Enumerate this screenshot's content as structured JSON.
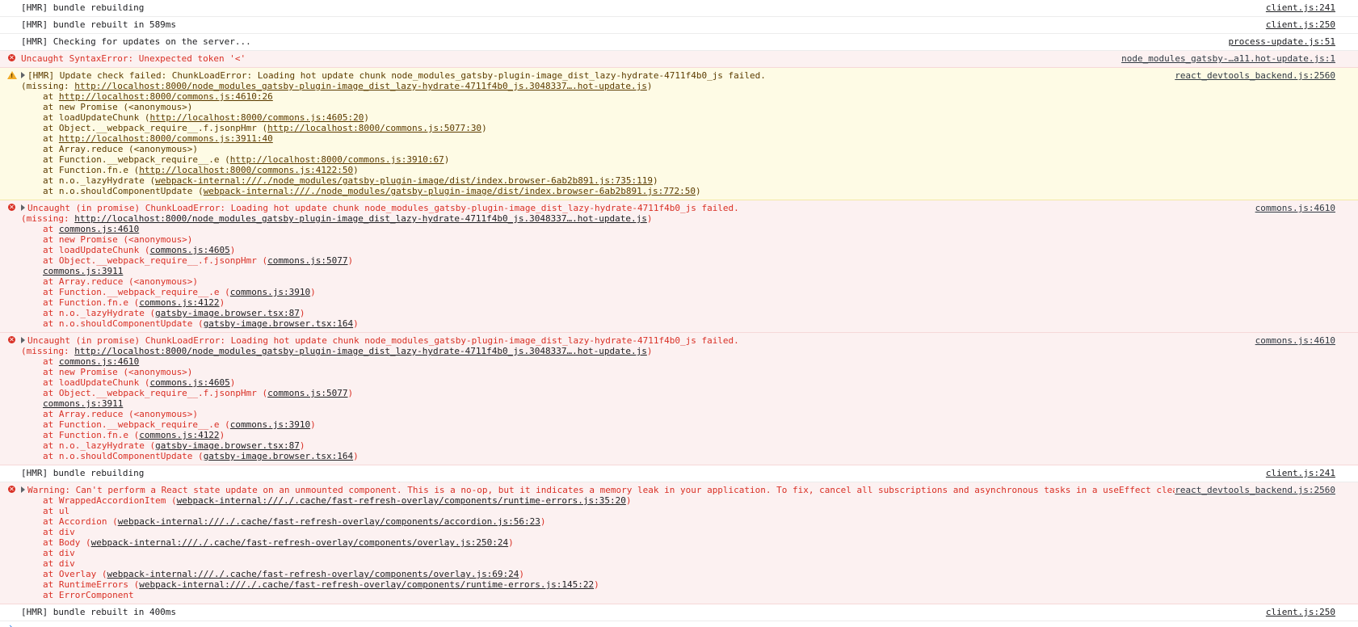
{
  "messages": [
    {
      "level": "info",
      "text": "[HMR] bundle rebuilding",
      "source": "client.js:241"
    },
    {
      "level": "info",
      "text": "[HMR] bundle rebuilt in 589ms",
      "source": "client.js:250"
    },
    {
      "level": "info",
      "text": "[HMR] Checking for updates on the server...",
      "source": "process-update.js:51"
    },
    {
      "level": "error",
      "text": "Uncaught SyntaxError: Unexpected token '<'",
      "source": "node_modules_gatsby-…a11.hot-update.js:1"
    },
    {
      "level": "warning",
      "expandable": true,
      "text": "[HMR] Update check failed: ChunkLoadError: Loading hot update chunk node_modules_gatsby-plugin-image_dist_lazy-hydrate-4711f4b0_js failed.",
      "missing_prefix": "(missing: ",
      "missing_url": "http://localhost:8000/node_modules_gatsby-plugin-image_dist_lazy-hydrate-4711f4b0_js.3048337….hot-update.js",
      "missing_suffix": ")",
      "source": "react_devtools_backend.js:2560",
      "stack": [
        {
          "pre": "at ",
          "link": "http://localhost:8000/commons.js:4610:26",
          "post": ""
        },
        {
          "pre": "at new Promise (<anonymous>)",
          "link": "",
          "post": ""
        },
        {
          "pre": "at loadUpdateChunk (",
          "link": "http://localhost:8000/commons.js:4605:20",
          "post": ")"
        },
        {
          "pre": "at Object.__webpack_require__.f.jsonpHmr (",
          "link": "http://localhost:8000/commons.js:5077:30",
          "post": ")"
        },
        {
          "pre": "at ",
          "link": "http://localhost:8000/commons.js:3911:40",
          "post": ""
        },
        {
          "pre": "at Array.reduce (<anonymous>)",
          "link": "",
          "post": ""
        },
        {
          "pre": "at Function.__webpack_require__.e (",
          "link": "http://localhost:8000/commons.js:3910:67",
          "post": ")"
        },
        {
          "pre": "at Function.fn.e (",
          "link": "http://localhost:8000/commons.js:4122:50",
          "post": ")"
        },
        {
          "pre": "at n.o._lazyHydrate (",
          "link": "webpack-internal:///./node_modules/gatsby-plugin-image/dist/index.browser-6ab2b891.js:735:119",
          "post": ")"
        },
        {
          "pre": "at n.o.shouldComponentUpdate (",
          "link": "webpack-internal:///./node_modules/gatsby-plugin-image/dist/index.browser-6ab2b891.js:772:50",
          "post": ")"
        }
      ]
    },
    {
      "level": "error",
      "expandable": true,
      "text": "Uncaught (in promise) ChunkLoadError: Loading hot update chunk node_modules_gatsby-plugin-image_dist_lazy-hydrate-4711f4b0_js failed.",
      "missing_prefix": "(missing: ",
      "missing_url": "http://localhost:8000/node_modules_gatsby-plugin-image_dist_lazy-hydrate-4711f4b0_js.3048337….hot-update.js",
      "missing_suffix": ")",
      "source": "commons.js:4610",
      "stack": [
        {
          "pre": "at ",
          "link": "commons.js:4610",
          "post": ""
        },
        {
          "pre": "at new Promise (<anonymous>)",
          "link": "",
          "post": ""
        },
        {
          "pre": "at loadUpdateChunk (",
          "link": "commons.js:4605",
          "post": ")"
        },
        {
          "pre": "at Object.__webpack_require__.f.jsonpHmr (",
          "link": "commons.js:5077",
          "post": ")"
        },
        {
          "pre": "",
          "link": "commons.js:3911",
          "post": ""
        },
        {
          "pre": "at Array.reduce (<anonymous>)",
          "link": "",
          "post": ""
        },
        {
          "pre": "at Function.__webpack_require__.e (",
          "link": "commons.js:3910",
          "post": ")"
        },
        {
          "pre": "at Function.fn.e (",
          "link": "commons.js:4122",
          "post": ")"
        },
        {
          "pre": "at n.o._lazyHydrate (",
          "link": "gatsby-image.browser.tsx:87",
          "post": ")"
        },
        {
          "pre": "at n.o.shouldComponentUpdate (",
          "link": "gatsby-image.browser.tsx:164",
          "post": ")"
        }
      ]
    },
    {
      "level": "error",
      "expandable": true,
      "text": "Uncaught (in promise) ChunkLoadError: Loading hot update chunk node_modules_gatsby-plugin-image_dist_lazy-hydrate-4711f4b0_js failed.",
      "missing_prefix": "(missing: ",
      "missing_url": "http://localhost:8000/node_modules_gatsby-plugin-image_dist_lazy-hydrate-4711f4b0_js.3048337….hot-update.js",
      "missing_suffix": ")",
      "source": "commons.js:4610",
      "stack": [
        {
          "pre": "at ",
          "link": "commons.js:4610",
          "post": ""
        },
        {
          "pre": "at new Promise (<anonymous>)",
          "link": "",
          "post": ""
        },
        {
          "pre": "at loadUpdateChunk (",
          "link": "commons.js:4605",
          "post": ")"
        },
        {
          "pre": "at Object.__webpack_require__.f.jsonpHmr (",
          "link": "commons.js:5077",
          "post": ")"
        },
        {
          "pre": "",
          "link": "commons.js:3911",
          "post": ""
        },
        {
          "pre": "at Array.reduce (<anonymous>)",
          "link": "",
          "post": ""
        },
        {
          "pre": "at Function.__webpack_require__.e (",
          "link": "commons.js:3910",
          "post": ")"
        },
        {
          "pre": "at Function.fn.e (",
          "link": "commons.js:4122",
          "post": ")"
        },
        {
          "pre": "at n.o._lazyHydrate (",
          "link": "gatsby-image.browser.tsx:87",
          "post": ")"
        },
        {
          "pre": "at n.o.shouldComponentUpdate (",
          "link": "gatsby-image.browser.tsx:164",
          "post": ")"
        }
      ]
    },
    {
      "level": "info",
      "text": "[HMR] bundle rebuilding",
      "source": "client.js:241"
    },
    {
      "level": "error",
      "expandable": true,
      "text": "Warning: Can't perform a React state update on an unmounted component. This is a no-op, but it indicates a memory leak in your application. To fix, cancel all subscriptions and asynchronous tasks in a useEffect cleanup function.",
      "source": "react_devtools_backend.js:2560",
      "stack": [
        {
          "pre": "at WrappedAccordionItem (",
          "link": "webpack-internal:///./.cache/fast-refresh-overlay/components/runtime-errors.js:35:20",
          "post": ")"
        },
        {
          "pre": "at ul",
          "link": "",
          "post": ""
        },
        {
          "pre": "at Accordion (",
          "link": "webpack-internal:///./.cache/fast-refresh-overlay/components/accordion.js:56:23",
          "post": ")"
        },
        {
          "pre": "at div",
          "link": "",
          "post": ""
        },
        {
          "pre": "at Body (",
          "link": "webpack-internal:///./.cache/fast-refresh-overlay/components/overlay.js:250:24",
          "post": ")"
        },
        {
          "pre": "at div",
          "link": "",
          "post": ""
        },
        {
          "pre": "at div",
          "link": "",
          "post": ""
        },
        {
          "pre": "at Overlay (",
          "link": "webpack-internal:///./.cache/fast-refresh-overlay/components/overlay.js:69:24",
          "post": ")"
        },
        {
          "pre": "at RuntimeErrors (",
          "link": "webpack-internal:///./.cache/fast-refresh-overlay/components/runtime-errors.js:145:22",
          "post": ")"
        },
        {
          "pre": "at ErrorComponent",
          "link": "",
          "post": ""
        }
      ]
    },
    {
      "level": "info",
      "text": "[HMR] bundle rebuilt in 400ms",
      "source": "client.js:250"
    }
  ],
  "icons": {
    "error": "error-circle-icon",
    "warning": "warning-triangle-icon",
    "expand": "expand-triangle-icon",
    "prompt": "prompt-chevron-icon"
  },
  "colors": {
    "error_text": "#d93025",
    "error_bg": "#fcf1f1",
    "warning_bg": "#fefbe5",
    "warning_text": "#5c3c00",
    "prompt": "#1a73e8"
  }
}
